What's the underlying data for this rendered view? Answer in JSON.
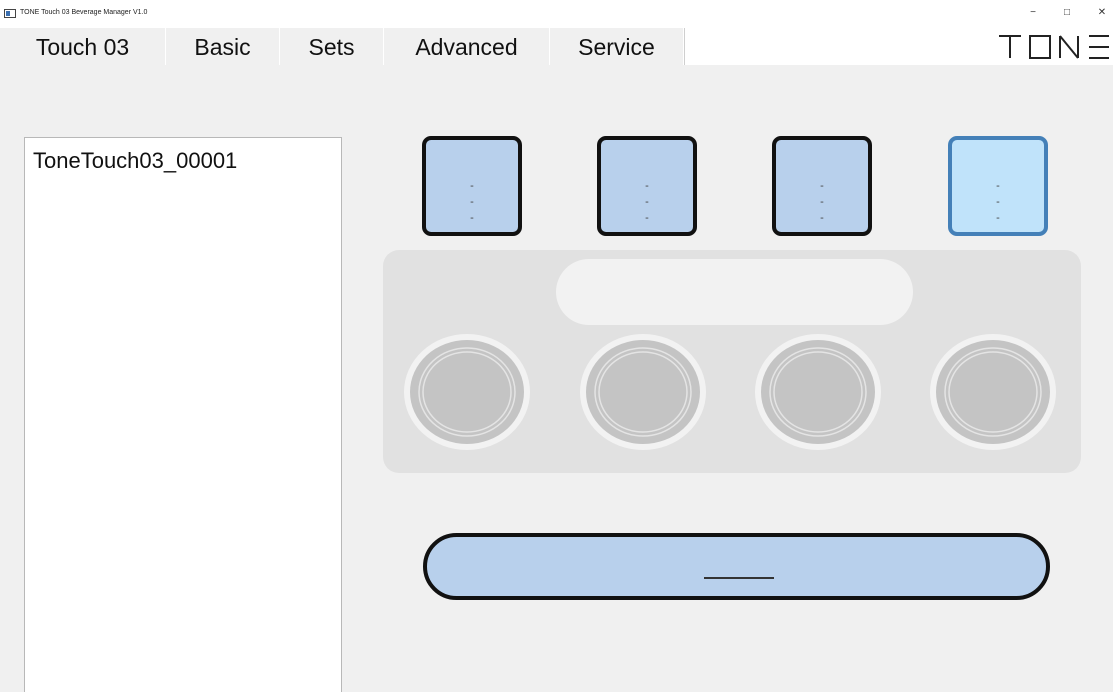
{
  "window": {
    "title": "TONE Touch 03   Beverage Manager   V1.0",
    "minimize_glyph": "−",
    "maximize_glyph": "□",
    "close_glyph": "✕"
  },
  "tabs": [
    {
      "label": "Touch 03",
      "active": true
    },
    {
      "label": "Basic",
      "active": false
    },
    {
      "label": "Sets",
      "active": false
    },
    {
      "label": "Advanced",
      "active": false
    },
    {
      "label": "Service",
      "active": false
    }
  ],
  "logo": {
    "text": "TONE"
  },
  "device_list": {
    "items": [
      "ToneTouch03_00001"
    ]
  },
  "beverage_slots": [
    {
      "lines": [
        "-",
        "-",
        "-"
      ],
      "selected": false
    },
    {
      "lines": [
        "-",
        "-",
        "-"
      ],
      "selected": false
    },
    {
      "lines": [
        "-",
        "-",
        "-"
      ],
      "selected": false
    },
    {
      "lines": [
        "-",
        "-",
        "-"
      ],
      "selected": true
    }
  ],
  "machine": {
    "display_text": "",
    "cups": 4
  },
  "colors": {
    "slot_fill": "#b8d0ec",
    "slot_selected_fill": "#c0e3fa",
    "slot_selected_border": "#4480b8",
    "machine_body": "#e1e1e1"
  }
}
